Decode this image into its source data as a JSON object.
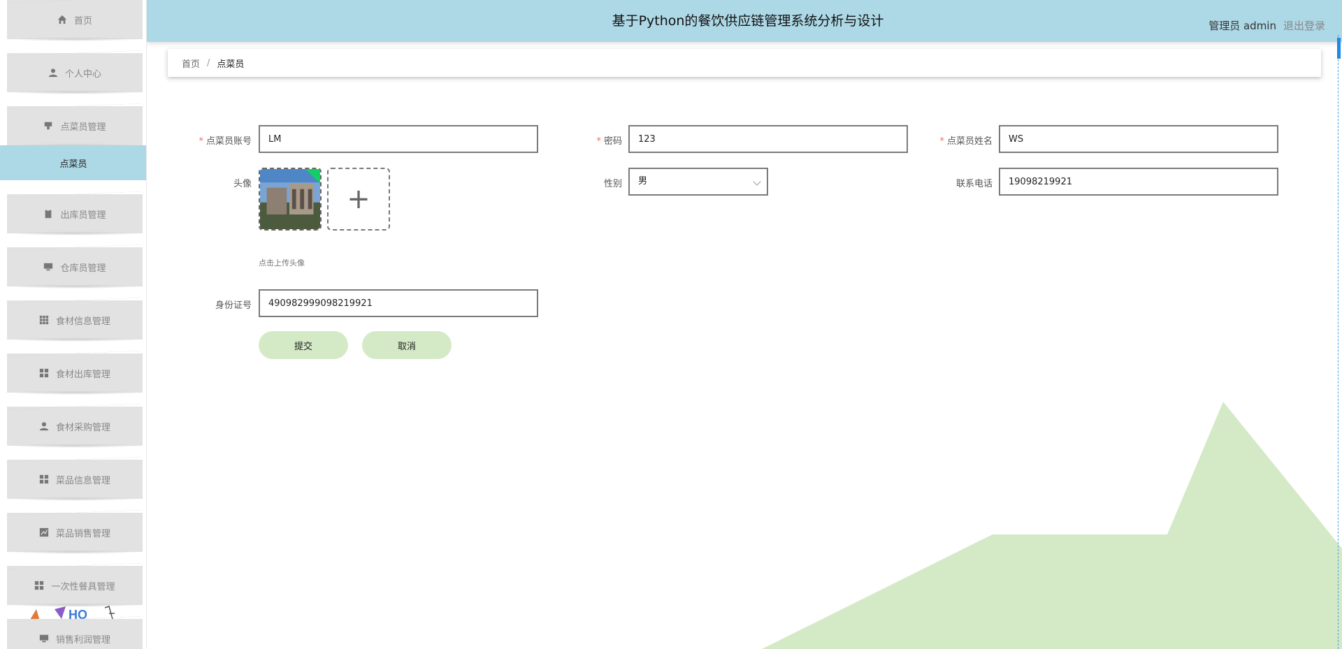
{
  "header": {
    "title": "基于Python的餐饮供应链管理系统分析与设计",
    "user_label": "管理员 admin",
    "logout_label": "退出登录"
  },
  "sidebar": {
    "items": [
      {
        "label": "首页",
        "icon": "home-icon"
      },
      {
        "label": "个人中心",
        "icon": "person-icon"
      },
      {
        "label": "点菜员管理",
        "icon": "stamp-icon"
      },
      {
        "label": "出库员管理",
        "icon": "clipboard-icon"
      },
      {
        "label": "仓库员管理",
        "icon": "monitor-icon"
      },
      {
        "label": "食材信息管理",
        "icon": "grid-icon"
      },
      {
        "label": "食材出库管理",
        "icon": "apps-icon"
      },
      {
        "label": "食材采购管理",
        "icon": "person-icon"
      },
      {
        "label": "菜品信息管理",
        "icon": "apps-icon"
      },
      {
        "label": "菜品销售管理",
        "icon": "chart-icon"
      },
      {
        "label": "一次性餐具管理",
        "icon": "apps-icon"
      },
      {
        "label": "销售利润管理",
        "icon": "monitor-icon"
      }
    ],
    "active_submenu": "点菜员"
  },
  "breadcrumb": {
    "home": "首页",
    "separator": "/",
    "current": "点菜员"
  },
  "form": {
    "account_label": "点菜员账号",
    "account_value": "LM",
    "password_label": "密码",
    "password_value": "123",
    "name_label": "点菜员姓名",
    "name_value": "WS",
    "avatar_label": "头像",
    "upload_tip": "点击上传头像",
    "gender_label": "性别",
    "gender_value": "男",
    "phone_label": "联系电话",
    "phone_value": "19098219921",
    "id_label": "身份证号",
    "id_value": "490982999098219921",
    "submit_label": "提交",
    "cancel_label": "取消",
    "required_mark": "*",
    "upload_plus": "+"
  },
  "colors": {
    "header_bg": "#add8e6",
    "active_menu_bg": "#add8e6",
    "menu_bg": "#e2e2e2",
    "button_bg": "#d4eac7",
    "deco_green": "#d4eac7",
    "required": "#f56c6c"
  }
}
